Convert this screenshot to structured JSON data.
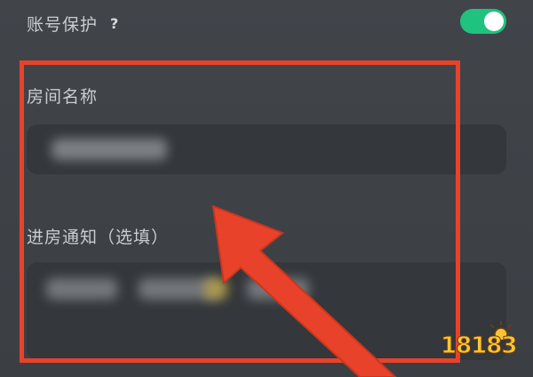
{
  "settings": {
    "account_protection_label": "账号保护",
    "help_symbol": "?",
    "toggle_on": true,
    "room_name_label": "房间名称",
    "room_name_value": "",
    "entry_notice_label": "进房通知（选填）",
    "entry_notice_value": ""
  },
  "watermark": {
    "text": "18183"
  },
  "colors": {
    "toggle": "#1fc27e",
    "highlight": "#e8432a",
    "background": "#3d4146"
  }
}
